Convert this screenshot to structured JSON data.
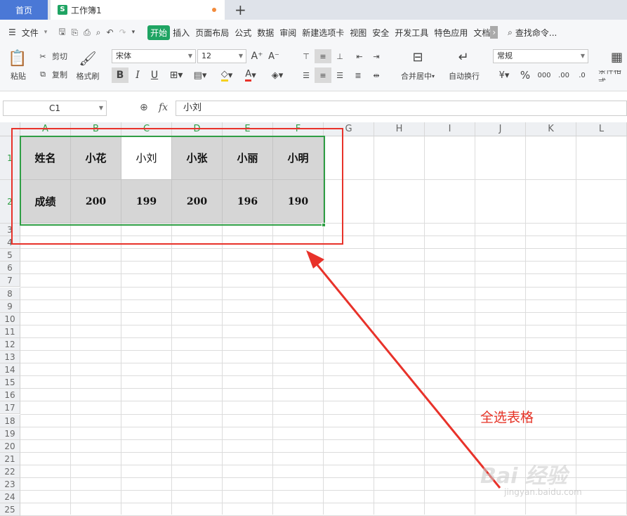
{
  "tabs": {
    "home": "首页",
    "doc": "工作簿1",
    "add": "+"
  },
  "menu": {
    "file": "文件",
    "items": [
      "开始",
      "插入",
      "页面布局",
      "公式",
      "数据",
      "审阅",
      "新建选项卡",
      "视图",
      "安全",
      "开发工具",
      "特色应用",
      "文档"
    ],
    "search": "查找命令..."
  },
  "toolbar": {
    "paste": "粘贴",
    "cut": "剪切",
    "copy": "复制",
    "format_painter": "格式刷",
    "font": "宋体",
    "font_size": "12",
    "bold": "B",
    "italic": "I",
    "underline": "U",
    "merge_center": "合并居中",
    "wrap_text": "自动换行",
    "number_format": "常规",
    "percent": "%",
    "conditional": "条件格式"
  },
  "formula_bar": {
    "name_box": "C1",
    "fx": "fx",
    "content": "小刘"
  },
  "columns": [
    "A",
    "B",
    "C",
    "D",
    "E",
    "F",
    "G",
    "H",
    "I",
    "J",
    "K",
    "L"
  ],
  "rows": [
    "1",
    "2",
    "3",
    "4",
    "5",
    "6",
    "7",
    "8",
    "9",
    "10",
    "11",
    "12",
    "13",
    "14",
    "15",
    "16",
    "17",
    "18",
    "19",
    "20",
    "21",
    "22",
    "23",
    "24",
    "25"
  ],
  "table": {
    "row1": [
      "姓名",
      "小花",
      "小刘",
      "小张",
      "小丽",
      "小明"
    ],
    "row2": [
      "成绩",
      "200",
      "199",
      "200",
      "196",
      "190"
    ]
  },
  "annotation": "全选表格",
  "watermark": {
    "main": "Bai 经验",
    "sub": "jingyan.baidu.com"
  },
  "colors": {
    "accent": "#1fa463",
    "selection": "#2f9e44",
    "highlight": "#e8322a",
    "home_tab": "#4a78d6"
  }
}
